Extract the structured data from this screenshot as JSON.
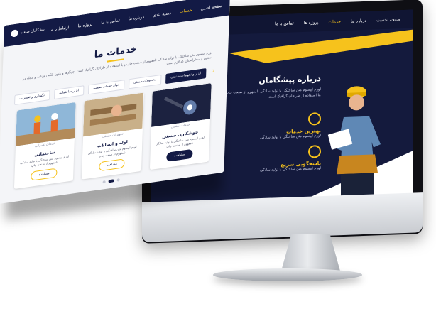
{
  "screen": {
    "nav": [
      "صفحه نخست",
      "درباره ما",
      "خدمات",
      "پروژه ها",
      "تماس با ما"
    ],
    "active_nav": "خدمات",
    "about_title": "درباره پیشگامان",
    "about_text": "لورم ایپسوم متن ساختگی با تولید سادگی نامفهوم از صنعت چاپ و با استفاده از طراحان گرافیک است.",
    "features": [
      {
        "title": "بهترین خدمات",
        "desc": "لورم ایپسوم متن ساختگی با تولید سادگی"
      },
      {
        "title": "پاسخگویی سریع",
        "desc": "لورم ایپسوم متن ساختگی با تولید سادگی"
      }
    ]
  },
  "page": {
    "logo_text": "پیشگامان صنعت",
    "nav": [
      "صفحه اصلی",
      "خدمات",
      "دسته بندی",
      "درباره ما",
      "تماس با ما",
      "پروژه ها",
      "ارتباط با ما"
    ],
    "active_nav": "خدمات",
    "services_title": "خدمات ما",
    "services_desc": "لورم ایپسوم متن ساختگی با تولید سادگی نامفهوم از صنعت چاپ و با استفاده از طراحان گرافیک است. چاپگرها و متون بلکه روزنامه و مجله در ستون و سطرآنچنان که لازم است.",
    "tabs": [
      "ابزار و تجهیزات صنعتی",
      "محصولات صنعتی",
      "انواع خدمات صنعتی",
      "ابزار ساختمانی",
      "نگهداری و تعمیرات"
    ],
    "cards": [
      {
        "title": "جوشکاری صنعتی",
        "sub": "خدمات صنعتی",
        "desc": "لورم ایپسوم متن ساختگی با تولید سادگی نامفهوم از صنعت چاپ",
        "btn": "مشاهده"
      },
      {
        "title": "لوله و اتصالات",
        "sub": "تجهیزات صنعتی",
        "desc": "لورم ایپسوم متن ساختگی با تولید سادگی نامفهوم از صنعت چاپ",
        "btn": "مشاهده"
      },
      {
        "title": "ساختمانی",
        "sub": "خدمات عمرانی",
        "desc": "لورم ایپسوم متن ساختگی با تولید سادگی نامفهوم از صنعت چاپ",
        "btn": "مشاهده"
      }
    ]
  },
  "colors": {
    "navy": "#131a45",
    "accent": "#f6c21c"
  }
}
